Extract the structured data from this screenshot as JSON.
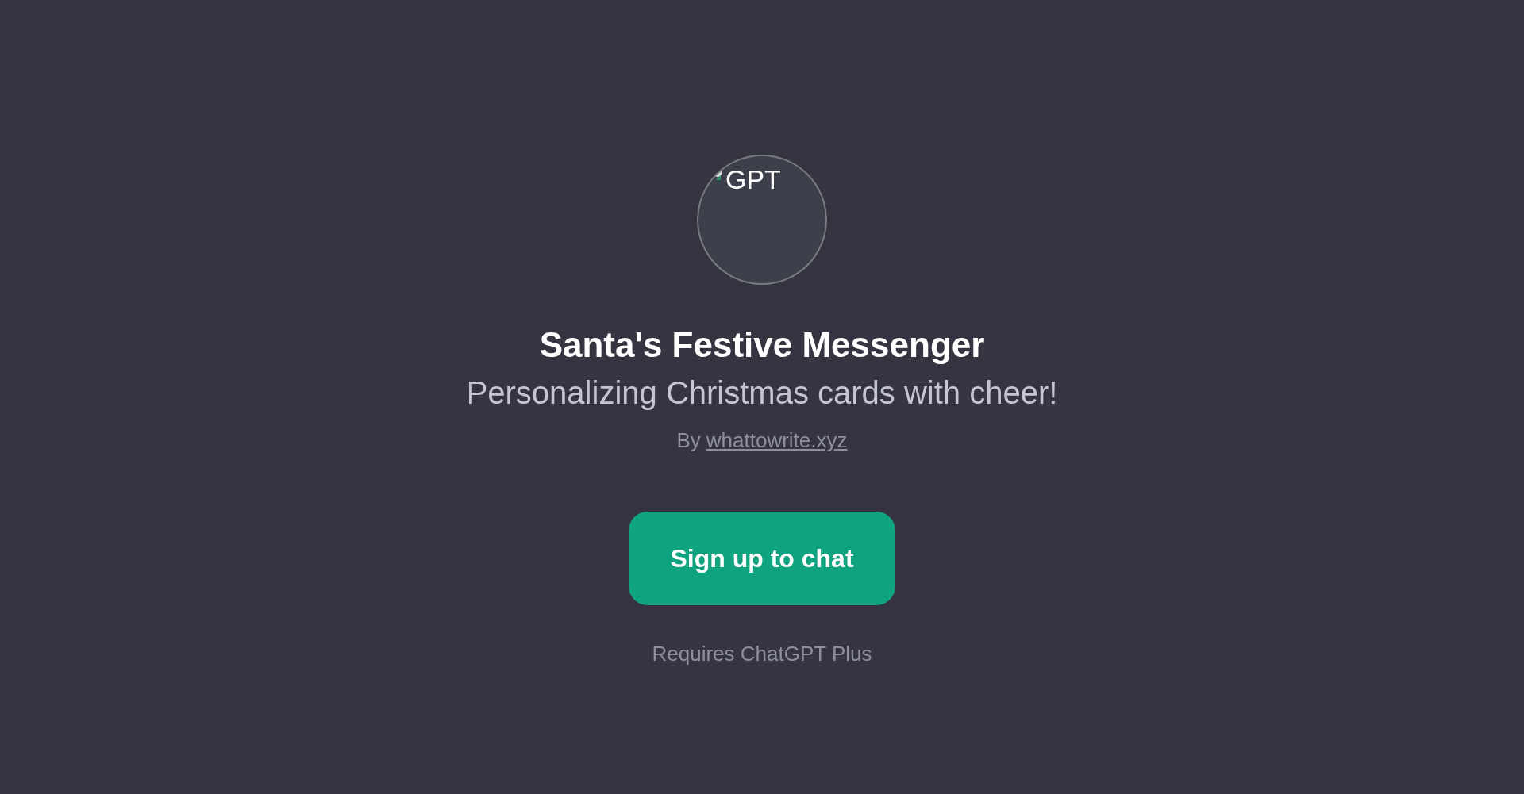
{
  "avatar": {
    "alt_text": "GPT"
  },
  "title": "Santa's Festive Messenger",
  "subtitle": "Personalizing Christmas cards with cheer!",
  "byline": {
    "prefix": "By",
    "author": "whattowrite.xyz"
  },
  "signup_button": "Sign up to chat",
  "requirement": "Requires ChatGPT Plus"
}
